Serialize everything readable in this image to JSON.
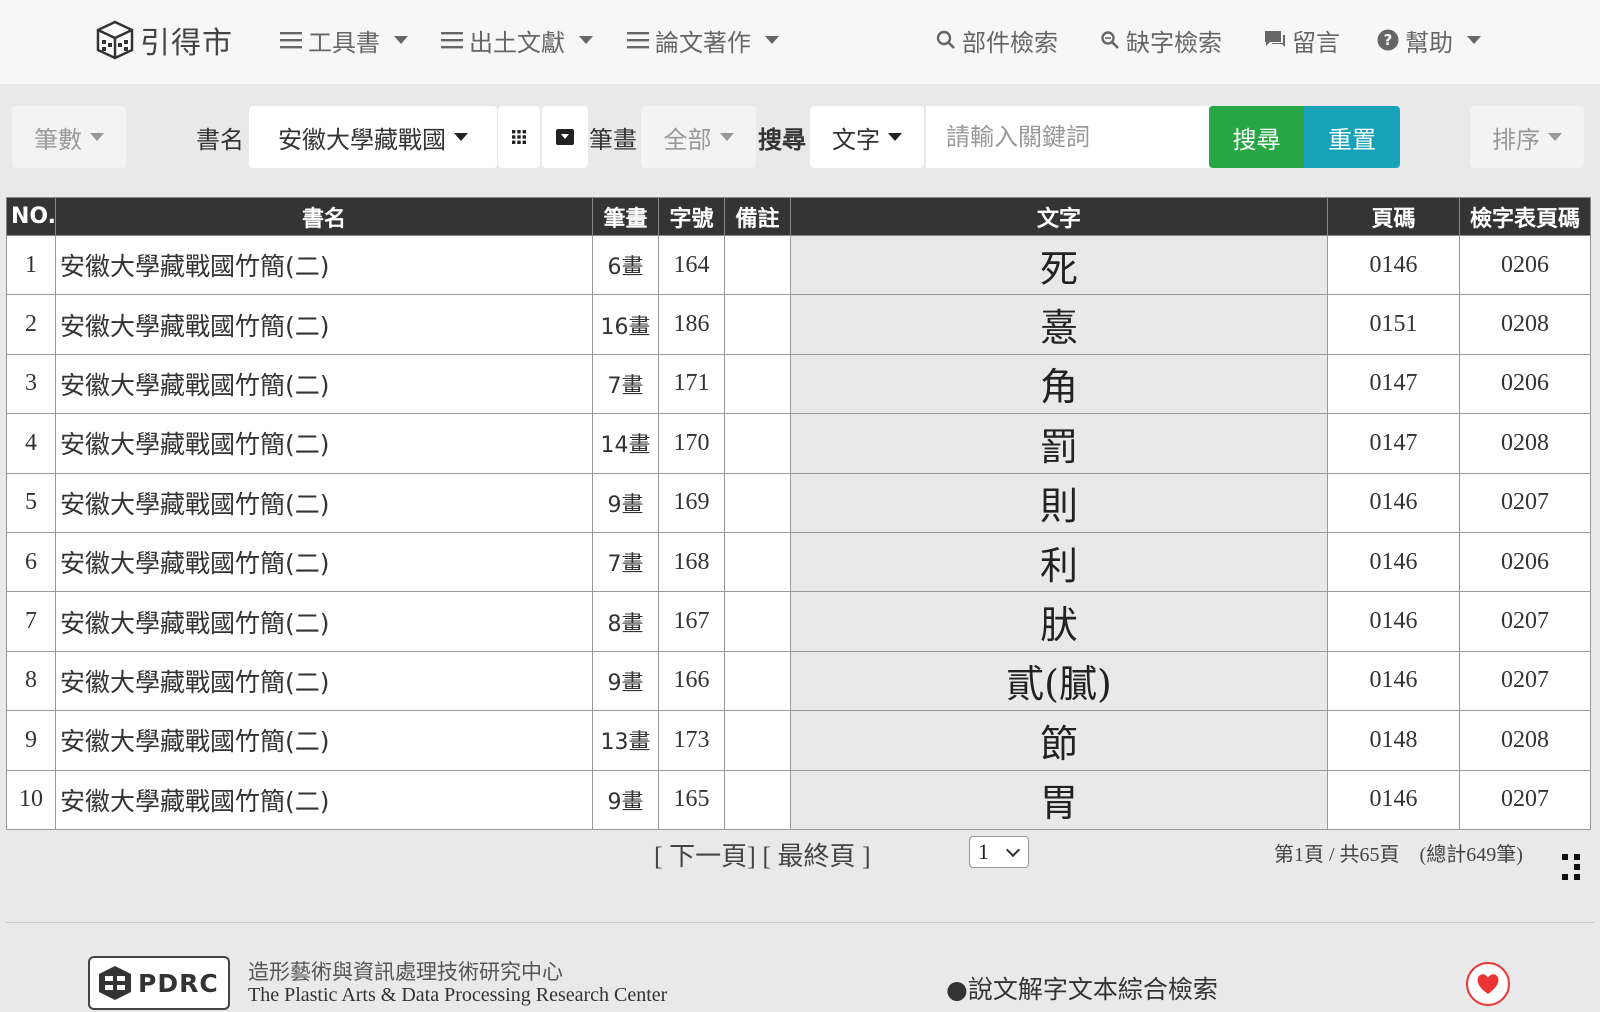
{
  "nav": {
    "brand": "引得市",
    "items": [
      {
        "label": "工具書",
        "icon": "menu-icon",
        "dropdown": true
      },
      {
        "label": "出土文獻",
        "icon": "menu-icon",
        "dropdown": true
      },
      {
        "label": "論文著作",
        "icon": "menu-icon",
        "dropdown": true
      }
    ],
    "right": [
      {
        "label": "部件檢索",
        "icon": "search-icon"
      },
      {
        "label": "缺字檢索",
        "icon": "search-key-icon"
      },
      {
        "label": "留言",
        "icon": "chat-icon"
      },
      {
        "label": "幫助",
        "icon": "help-circle-icon",
        "dropdown": true
      }
    ]
  },
  "toolbar": {
    "strokes_filter": "筆數",
    "book_label": "書名",
    "book_value": "安徽大學藏戰國",
    "stroke_label": "筆畫",
    "stroke_value": "全部",
    "search_label": "搜尋",
    "search_type": "文字",
    "search_placeholder": "請輸入關鍵詞",
    "search_button": "搜尋",
    "reset_button": "重置",
    "sort_button": "排序"
  },
  "table": {
    "headers": [
      "NO.",
      "書名",
      "筆畫",
      "字號",
      "備註",
      "文字",
      "頁碼",
      "檢字表頁碼"
    ],
    "rows": [
      {
        "no": "1",
        "book": "安徽大學藏戰國竹簡(二)",
        "strokes": "6畫",
        "code": "164",
        "note": "",
        "char": "死",
        "page": "0146",
        "index_page": "0206"
      },
      {
        "no": "2",
        "book": "安徽大學藏戰國竹簡(二)",
        "strokes": "16畫",
        "code": "186",
        "note": "",
        "char": "憙",
        "page": "0151",
        "index_page": "0208"
      },
      {
        "no": "3",
        "book": "安徽大學藏戰國竹簡(二)",
        "strokes": "7畫",
        "code": "171",
        "note": "",
        "char": "角",
        "page": "0147",
        "index_page": "0206"
      },
      {
        "no": "4",
        "book": "安徽大學藏戰國竹簡(二)",
        "strokes": "14畫",
        "code": "170",
        "note": "",
        "char": "罰",
        "page": "0147",
        "index_page": "0208"
      },
      {
        "no": "5",
        "book": "安徽大學藏戰國竹簡(二)",
        "strokes": "9畫",
        "code": "169",
        "note": "",
        "char": "則",
        "page": "0146",
        "index_page": "0207"
      },
      {
        "no": "6",
        "book": "安徽大學藏戰國竹簡(二)",
        "strokes": "7畫",
        "code": "168",
        "note": "",
        "char": "利",
        "page": "0146",
        "index_page": "0206"
      },
      {
        "no": "7",
        "book": "安徽大學藏戰國竹簡(二)",
        "strokes": "8畫",
        "code": "167",
        "note": "",
        "char": "肰",
        "page": "0146",
        "index_page": "0207"
      },
      {
        "no": "8",
        "book": "安徽大學藏戰國竹簡(二)",
        "strokes": "9畫",
        "code": "166",
        "note": "",
        "char": "貳(膩)",
        "page": "0146",
        "index_page": "0207"
      },
      {
        "no": "9",
        "book": "安徽大學藏戰國竹簡(二)",
        "strokes": "13畫",
        "code": "173",
        "note": "",
        "char": "節",
        "page": "0148",
        "index_page": "0208"
      },
      {
        "no": "10",
        "book": "安徽大學藏戰國竹簡(二)",
        "strokes": "9畫",
        "code": "165",
        "note": "",
        "char": "胃",
        "page": "0146",
        "index_page": "0207"
      }
    ]
  },
  "pagination": {
    "next": "[ 下一頁]",
    "last": "[ 最終頁 ]",
    "current": "1",
    "info": "第1頁 / 共65頁　(總計649筆)"
  },
  "footer": {
    "logo": "PDRC",
    "org_zh": "造形藝術與資訊處理技術研究中心",
    "org_en": "The Plastic Arts & Data Processing Research Center",
    "link": "●說文解字文本綜合檢索"
  },
  "colors": {
    "search": "#28a745",
    "reset": "#17a2b8",
    "header_bg": "#343434"
  }
}
